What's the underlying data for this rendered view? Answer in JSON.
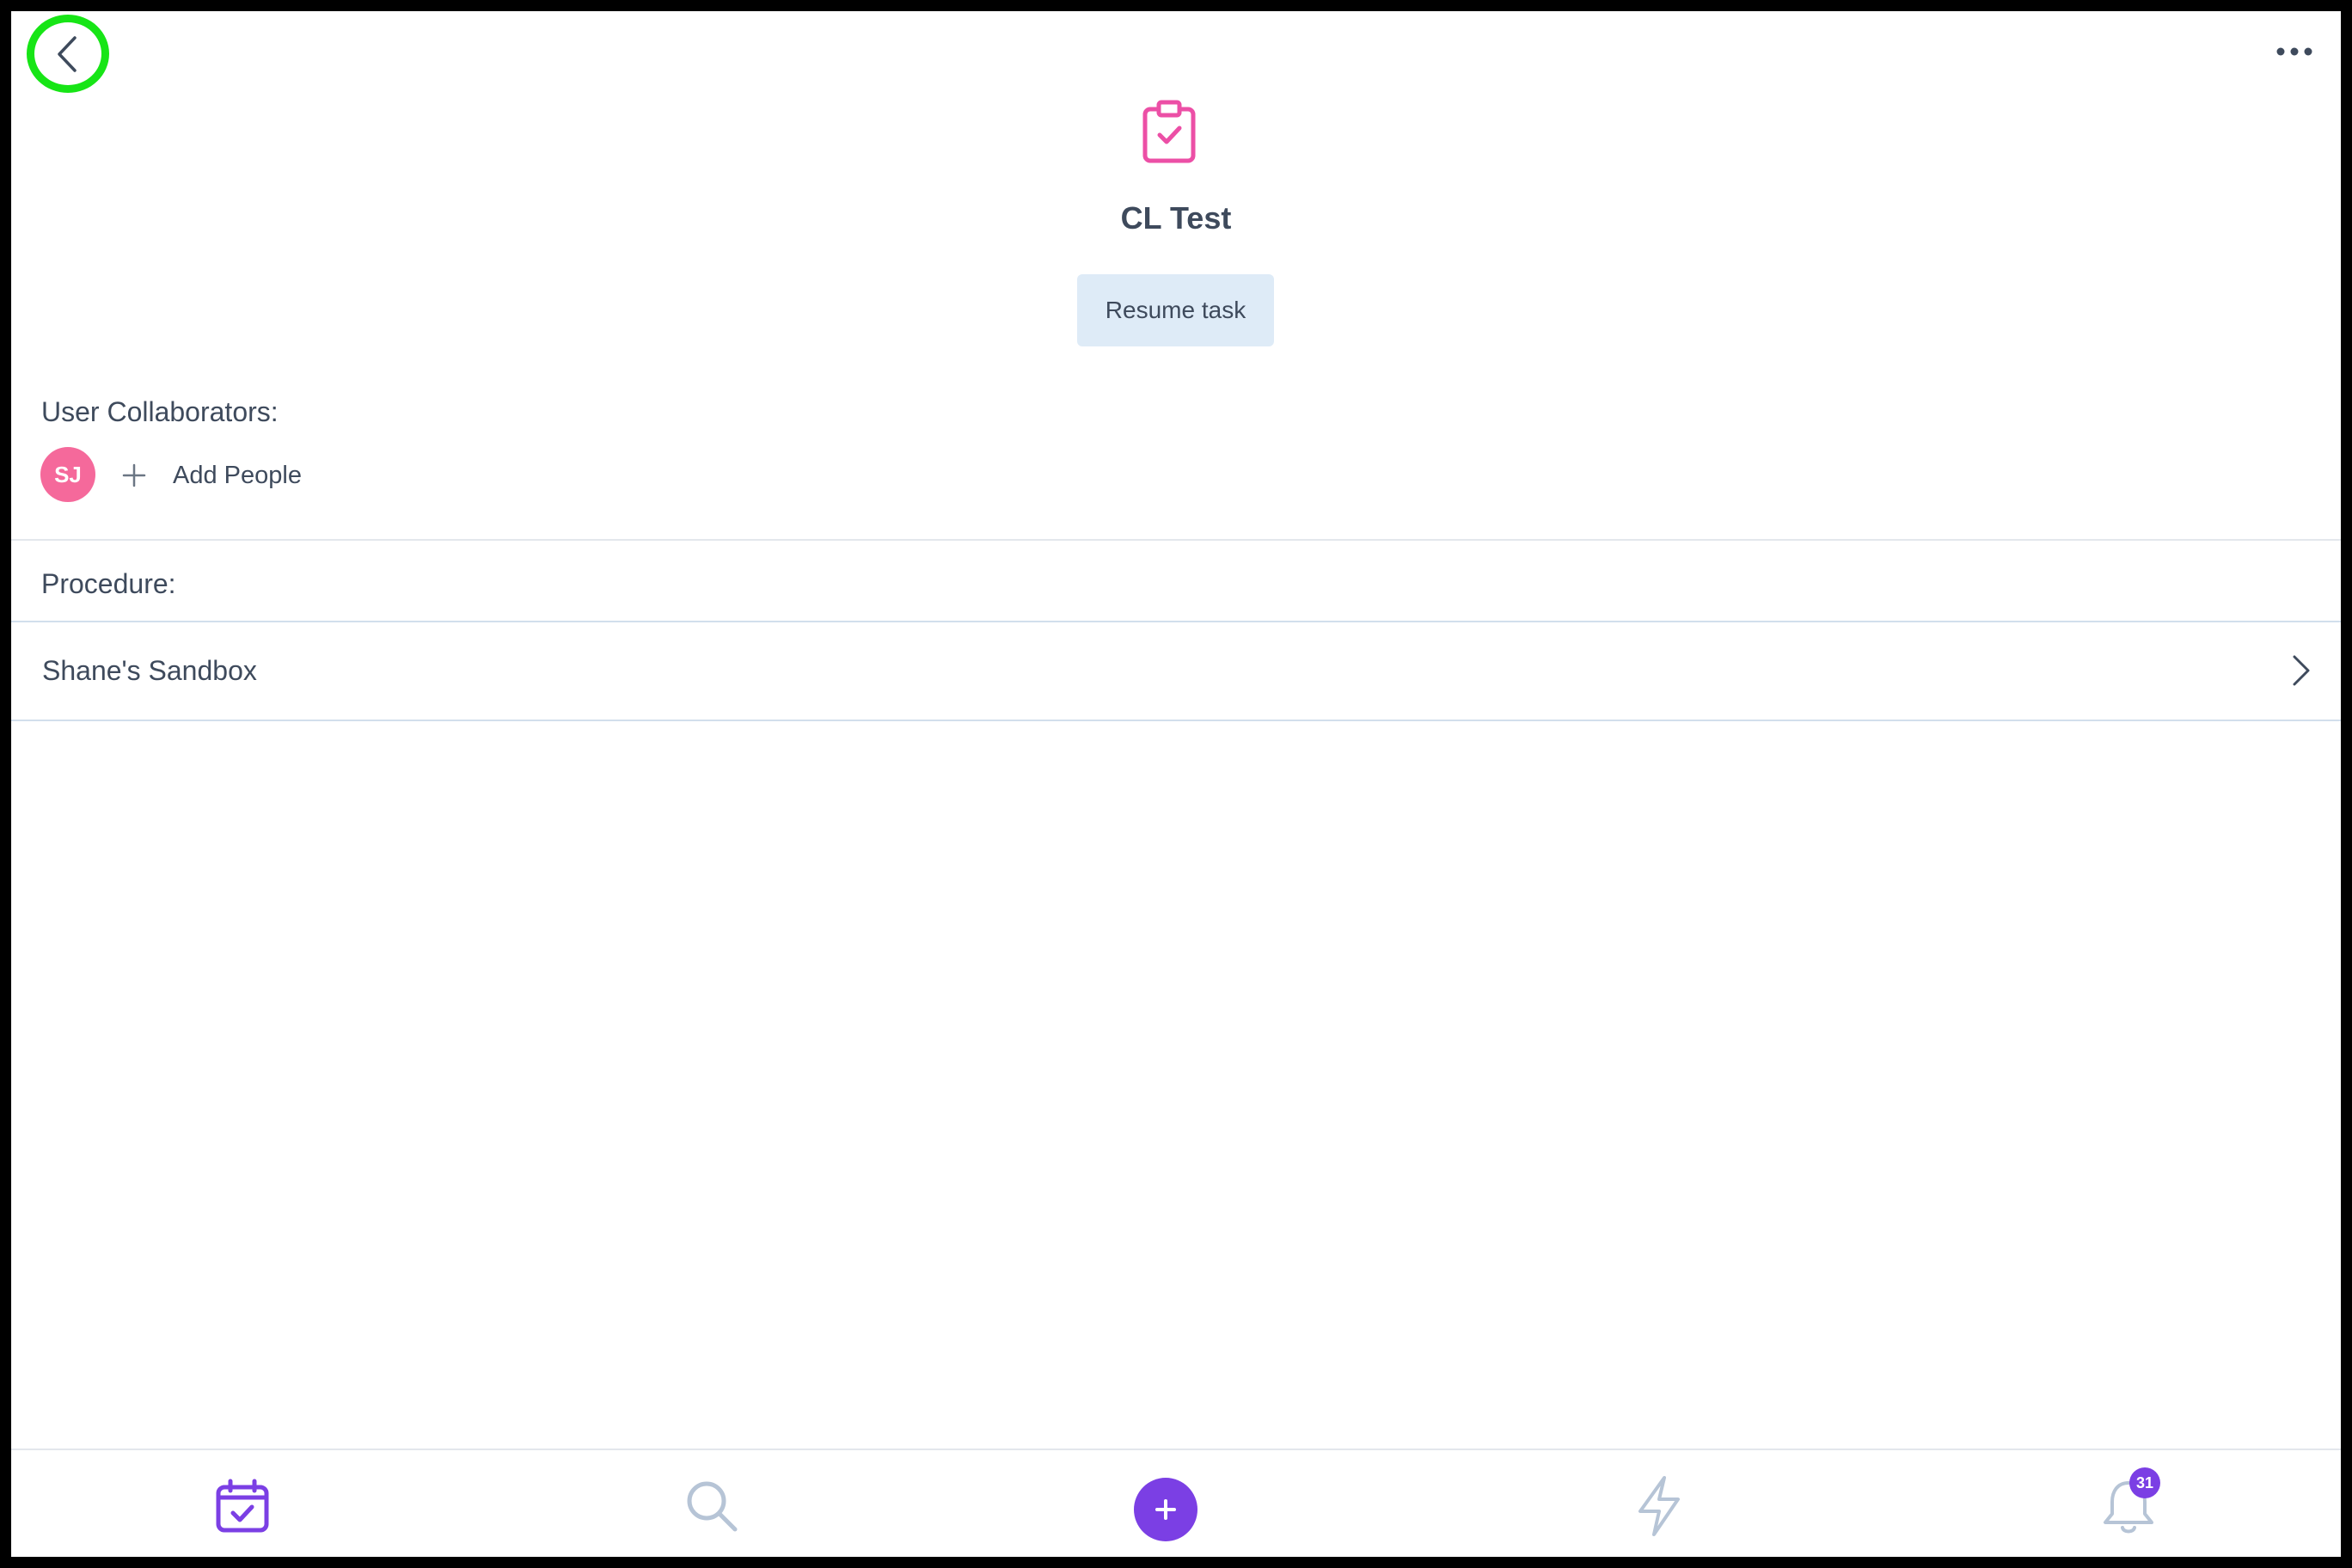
{
  "header": {
    "back_icon": "chevron-left-icon",
    "more_icon": "more-horizontal-icon"
  },
  "task": {
    "icon": "clipboard-check-icon",
    "title": "CL Test",
    "resume_label": "Resume task"
  },
  "collaborators": {
    "label": "User Collaborators:",
    "users": [
      {
        "initials": "SJ",
        "color": "#f5699b"
      }
    ],
    "add_label": "Add People"
  },
  "procedure": {
    "label": "Procedure:",
    "name": "Shane's Sandbox"
  },
  "tab_bar": {
    "tabs": [
      {
        "icon": "calendar-check-icon",
        "active": true
      },
      {
        "icon": "search-icon",
        "active": false
      },
      {
        "icon": "plus-icon",
        "active": false
      },
      {
        "icon": "lightning-icon",
        "active": false
      },
      {
        "icon": "bell-icon",
        "active": false,
        "badge": "31"
      }
    ]
  },
  "colors": {
    "accent": "#7b3fe4",
    "task_icon": "#ec4fa6",
    "highlight_ring": "#17e516",
    "text": "#3e4a5c",
    "button_bg": "#deebf7"
  }
}
